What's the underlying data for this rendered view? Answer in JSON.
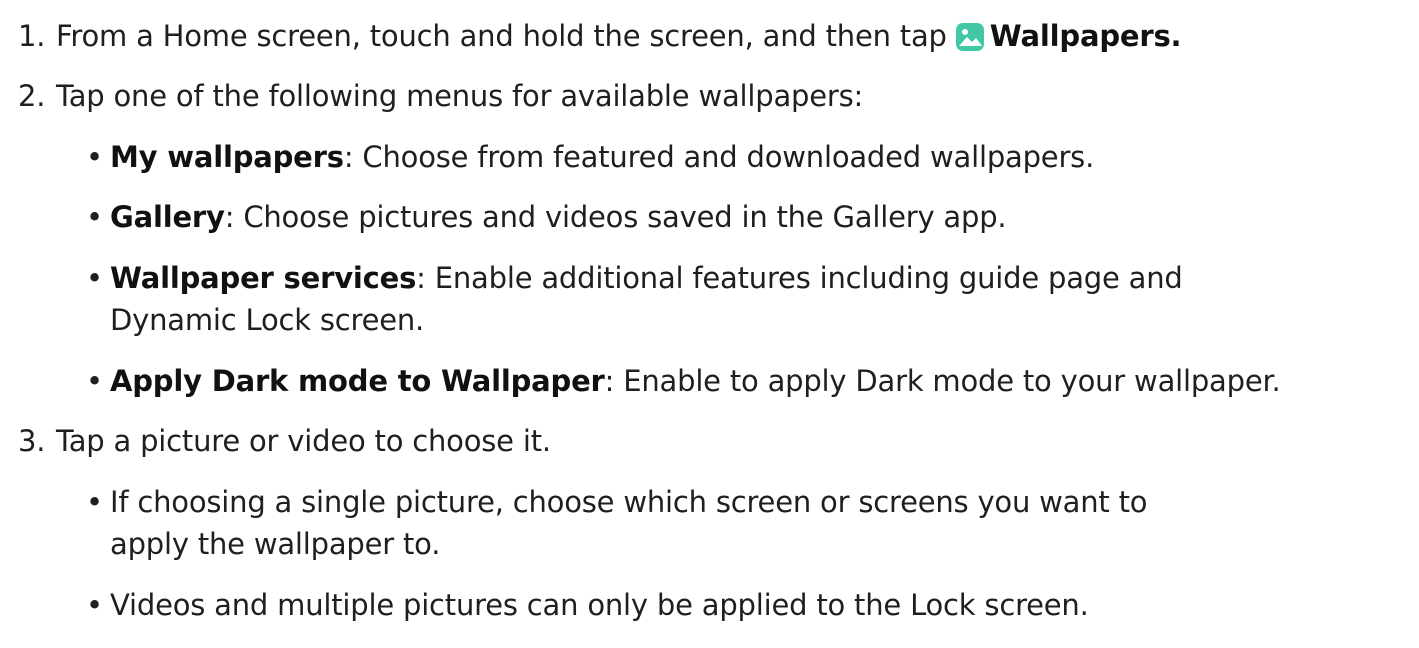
{
  "steps": [
    {
      "number": "1.",
      "text_before": "From a Home screen, touch and hold the screen, and then tap",
      "icon": "wallpapers-app-icon",
      "bold_label": "Wallpapers",
      "text_after": "."
    },
    {
      "number": "2.",
      "text": "Tap one of the following menus for available wallpapers:",
      "bullets": [
        {
          "term": "My wallpapers",
          "separator": ":",
          "desc": " Choose from featured and downloaded wallpapers."
        },
        {
          "term": "Gallery",
          "separator": ":",
          "desc": " Choose pictures and videos saved in the Gallery app."
        },
        {
          "term": "Wallpaper services",
          "separator": ":",
          "desc_line1": " Enable additional features including guide page and",
          "desc_line2": "Dynamic Lock screen."
        },
        {
          "term": "Apply Dark mode to Wallpaper",
          "separator": ":",
          "desc": " Enable to apply Dark mode to your wallpaper."
        }
      ]
    },
    {
      "number": "3.",
      "text": "Tap a picture or video to choose it.",
      "bullets": [
        {
          "line1": "If choosing a single picture, choose which screen or screens you want to",
          "line2": "apply the wallpaper to."
        },
        {
          "line1": "Videos and multiple pictures can only be applied to the Lock screen."
        }
      ]
    }
  ],
  "bullet_glyph": "•",
  "colors": {
    "text": "#1f1f1f",
    "bold": "#111111",
    "icon_bg": "#41c9a6"
  }
}
